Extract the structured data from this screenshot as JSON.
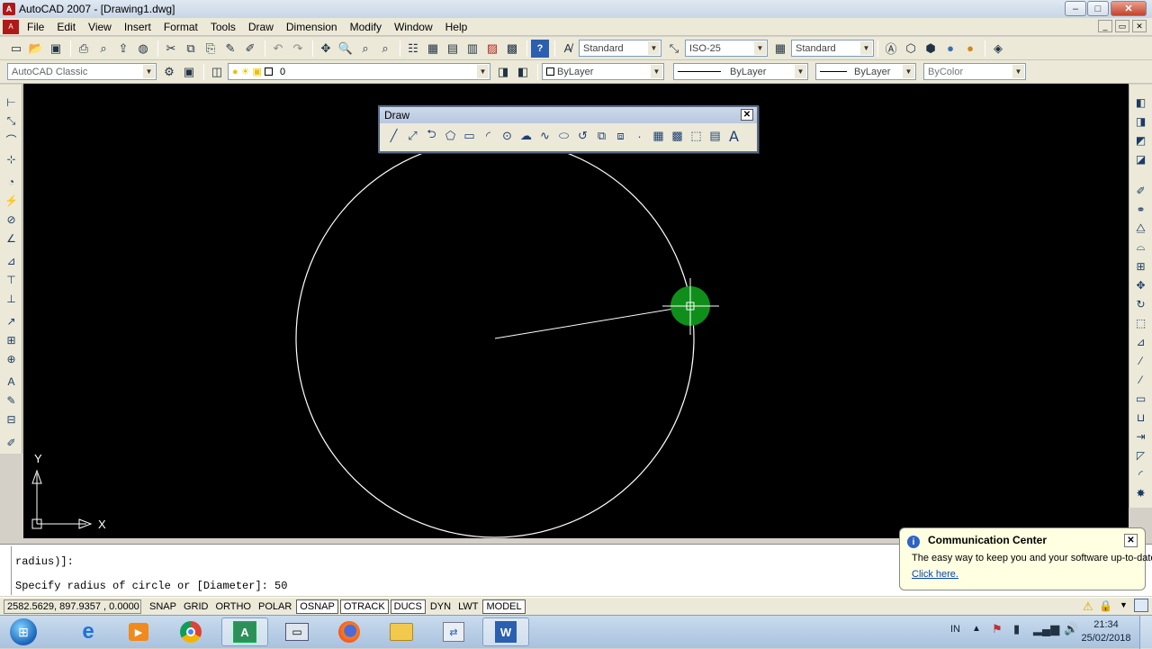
{
  "titlebar": {
    "app_title": "AutoCAD 2007 - [Drawing1.dwg]",
    "app_icon_label": "A",
    "minimize": "–",
    "maximize": "□",
    "close": "✕"
  },
  "menubar": {
    "items": [
      "File",
      "Edit",
      "View",
      "Insert",
      "Format",
      "Tools",
      "Draw",
      "Dimension",
      "Modify",
      "Window",
      "Help"
    ]
  },
  "toolbar": {
    "text_style": "Standard",
    "dim_style": "ISO-25",
    "table_style": "Standard",
    "workspace": "AutoCAD Classic",
    "layer": "0",
    "color": "ByLayer",
    "linetype": "ByLayer",
    "lineweight": "ByLayer",
    "plotstyle": "ByColor"
  },
  "draw_toolbar": {
    "title": "Draw",
    "close": "✕"
  },
  "ucs": {
    "y_label": "Y",
    "x_label": "X"
  },
  "command": {
    "line1": "radius)]:",
    "line2": "Specify radius of circle or [Diameter]: 50"
  },
  "status": {
    "coords": "2582.5629, 897.9357 , 0.0000",
    "toggles": [
      {
        "label": "SNAP",
        "on": false
      },
      {
        "label": "GRID",
        "on": false
      },
      {
        "label": "ORTHO",
        "on": false
      },
      {
        "label": "POLAR",
        "on": false
      },
      {
        "label": "OSNAP",
        "on": true
      },
      {
        "label": "OTRACK",
        "on": true
      },
      {
        "label": "DUCS",
        "on": true
      },
      {
        "label": "DYN",
        "on": false
      },
      {
        "label": "LWT",
        "on": false
      },
      {
        "label": "MODEL",
        "on": true
      }
    ]
  },
  "comm_center": {
    "title": "Communication Center",
    "body": "The easy way to keep you and your software up-to-date.",
    "link": "Click here.",
    "close": "✕"
  },
  "tray": {
    "lang": "IN",
    "time": "21:34",
    "date": "25/02/2018"
  },
  "colors": {
    "accent": "#0a246a",
    "snap_marker": "#0f8f1a",
    "canvas": "#000000"
  }
}
